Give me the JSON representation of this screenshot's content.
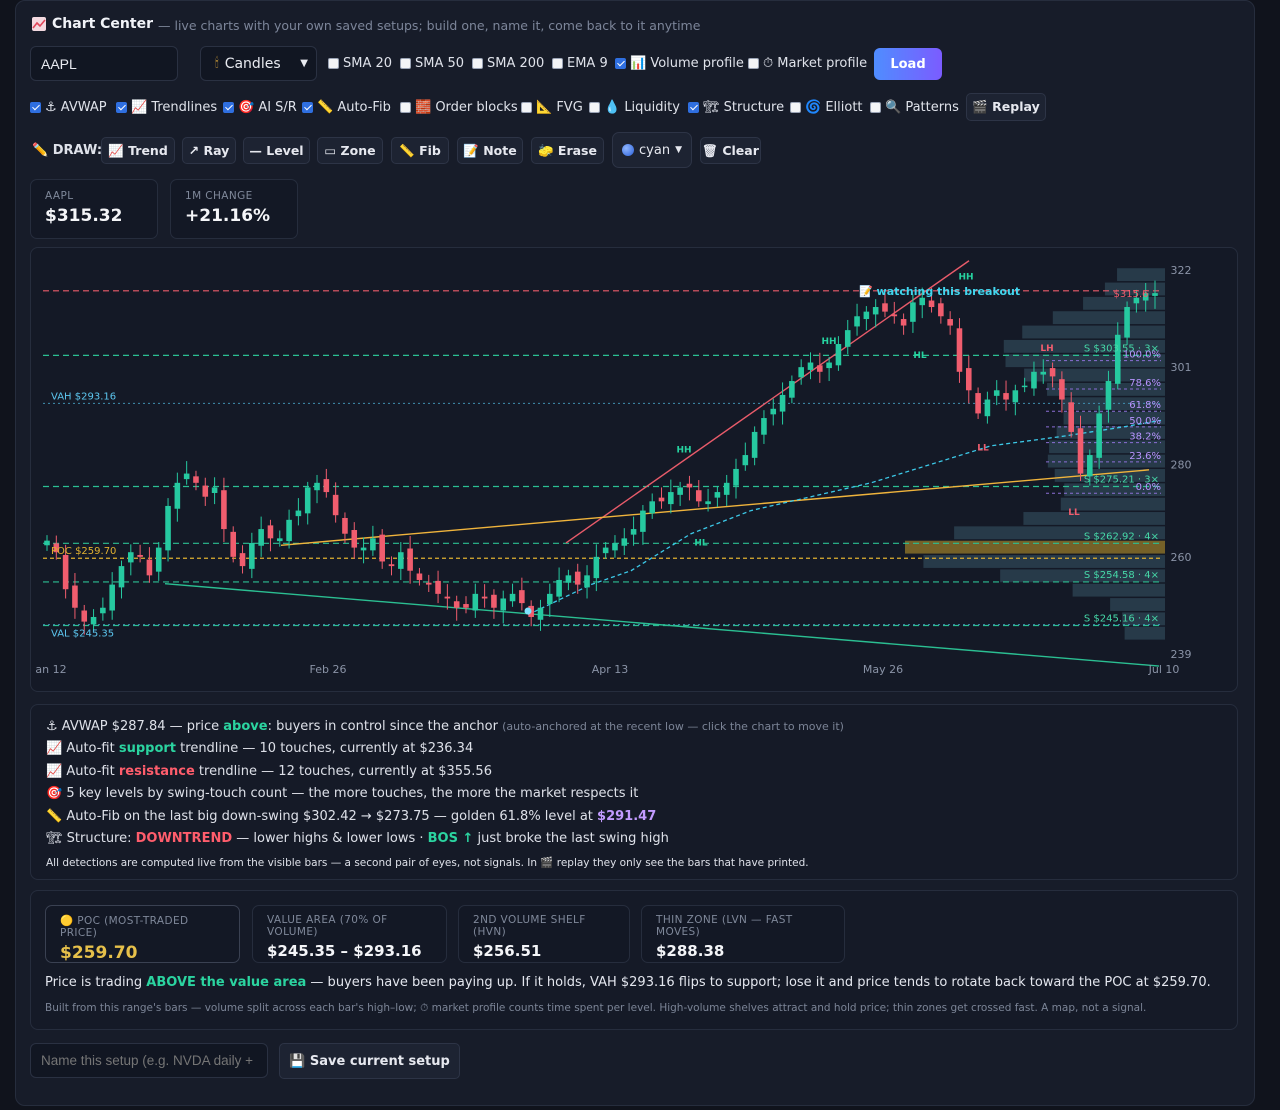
{
  "header": {
    "icon": "chart-icon",
    "title": "Chart Center",
    "subtitle": "— live charts with your own saved setups; build one, name it, come back to it anytime"
  },
  "toolbar": {
    "symbol": "AAPL",
    "chart_type": "Candles",
    "load_label": "Load",
    "overlays": [
      {
        "label": "SMA 20",
        "checked": false
      },
      {
        "label": "SMA 50",
        "checked": false
      },
      {
        "label": "SMA 200",
        "checked": false
      },
      {
        "label": "EMA 9",
        "checked": false
      },
      {
        "label": "📊 Volume profile",
        "checked": true
      },
      {
        "label": "⏱ Market profile",
        "checked": false
      }
    ]
  },
  "detections": {
    "items": [
      {
        "label": "⚓ AVWAP",
        "checked": true
      },
      {
        "label": "📈 Trendlines",
        "checked": true
      },
      {
        "label": "🎯 AI S/R",
        "checked": true
      },
      {
        "label": "📏 Auto-Fib",
        "checked": true
      },
      {
        "label": "🧱 Order blocks",
        "checked": false
      },
      {
        "label": "📐 FVG",
        "checked": false
      },
      {
        "label": "💧 Liquidity",
        "checked": false
      },
      {
        "label": "🏗 Structure",
        "checked": true
      },
      {
        "label": "🌀 Elliott",
        "checked": false
      },
      {
        "label": "🔍 Patterns",
        "checked": false
      }
    ],
    "replay_label": "🎬 Replay"
  },
  "draw": {
    "label": "✏️ DRAW:",
    "tools": [
      "📈 Trend",
      "↗ Ray",
      "— Level",
      "▭ Zone",
      "📏 Fib",
      "📝 Note",
      "🧽 Erase"
    ],
    "color": "cyan",
    "clear_label": "🗑 Clear"
  },
  "stats": {
    "symbol_label": "AAPL",
    "price": "$315.32",
    "change_label": "1M CHANGE",
    "change": "+21.16%"
  },
  "colors": {
    "up": "#26c9a0",
    "down": "#f05d6e",
    "accent": "#5b7cff",
    "poc": "#e0b030",
    "avwap": "#f0b43c",
    "vwap_line": "#3cc9e8",
    "green_text": "#2bd4a0",
    "red_text": "#ff5d6c"
  },
  "chart": {
    "y_ticks": [
      "322",
      "301",
      "280",
      "260",
      "239"
    ],
    "x_ticks": [
      "an 12",
      "Feb 26",
      "Apr 13",
      "May 26",
      "Jul 10"
    ],
    "labels": {
      "vah": "VAH $293.16",
      "poc": "POC $259.70",
      "val": "VAL $245.35",
      "note": "📝 watching this breakout",
      "last_price": "$315.6"
    },
    "sr_labels": [
      "S $303.55 · 3×",
      "S $275.21 · 3×",
      "S $262.92 · 4×",
      "S $254.58 · 4×",
      "S $245.16 · 4×"
    ],
    "fib_labels": [
      "100.0%",
      "78.6%",
      "61.8%",
      "50.0%",
      "38.2%",
      "23.6%",
      "0.0%"
    ],
    "structure_labels": [
      "HH",
      "HH",
      "HL",
      "HH",
      "HL",
      "HH",
      "LH",
      "LL",
      "LL"
    ]
  },
  "chart_data": {
    "type": "candlestick",
    "symbol": "AAPL",
    "x_range": [
      "Jan 12",
      "Jul 10"
    ],
    "ylim": [
      239,
      322
    ],
    "close_series": [
      263.5,
      261,
      253,
      249,
      246,
      247,
      249,
      254,
      258,
      261,
      260,
      256,
      262,
      271,
      276,
      278,
      276,
      273,
      275,
      266,
      260,
      258,
      263,
      266,
      264,
      264,
      268,
      270,
      275,
      276,
      274,
      269,
      265,
      262,
      262,
      264,
      259,
      258,
      261,
      257,
      255,
      254,
      252,
      251,
      249,
      249,
      252,
      251,
      249,
      251,
      252,
      250,
      247,
      249,
      252,
      255,
      256,
      254,
      256,
      260,
      262,
      263,
      264,
      266,
      270,
      272,
      272,
      274,
      275,
      275,
      272,
      272,
      274,
      276,
      279,
      282,
      287,
      290,
      292,
      295,
      298,
      301,
      302,
      300,
      302,
      306,
      309,
      312,
      313,
      314,
      313,
      312,
      310,
      315,
      316,
      314,
      312,
      310,
      300,
      296,
      291,
      294,
      296,
      294,
      296,
      297,
      300,
      300,
      299,
      294,
      287,
      278,
      282,
      291,
      298,
      308,
      314,
      316,
      317,
      317
    ],
    "series": [
      {
        "name": "AVWAP",
        "value": 287.84
      },
      {
        "name": "support trendline",
        "value": 236.34
      },
      {
        "name": "resistance trendline",
        "value": 355.56
      }
    ],
    "support_resistance": [
      303.55,
      275.21,
      262.92,
      254.58,
      245.16
    ],
    "volume_profile": {
      "poc": 259.7,
      "vah": 293.16,
      "val": 245.35,
      "hvn": 256.51,
      "lvn": 288.38
    },
    "fib": {
      "from": 302.42,
      "to": 273.75,
      "golden": 291.47
    }
  },
  "info": {
    "avwap": {
      "a": "⚓ AVWAP $287.84 — price ",
      "b": "above",
      "c": ": buyers in control since the anchor ",
      "d": "(auto-anchored at the recent low — click the chart to move it)"
    },
    "support": {
      "a": "📈 Auto-fit ",
      "b": "support",
      "c": " trendline — 10 touches, currently at $236.34"
    },
    "resistance": {
      "a": "📈 Auto-fit ",
      "b": "resistance",
      "c": " trendline — 12 touches, currently at $355.56"
    },
    "levels": "🎯 5 key levels by swing-touch count — the more touches, the more the market respects it",
    "fib": {
      "a": "📏 Auto-Fib on the last big down-swing $302.42 → $273.75 — golden 61.8% level at ",
      "b": "$291.47"
    },
    "structure": {
      "a": "🏗 Structure: ",
      "b": "DOWNTREND",
      "c": " — lower highs & lower lows · ",
      "d": "BOS ↑",
      "e": " just broke the last swing high"
    },
    "footnote": "All detections are computed live from the visible bars — a second pair of eyes, not signals. In 🎬 replay they only see the bars that have printed."
  },
  "volume_profile": {
    "cards": [
      {
        "label": "🟡 POC (MOST-TRADED PRICE)",
        "value": "$259.70"
      },
      {
        "label": "VALUE AREA (70% OF VOLUME)",
        "value": "$245.35 – $293.16"
      },
      {
        "label": "2ND VOLUME SHELF (HVN)",
        "value": "$256.51"
      },
      {
        "label": "THIN ZONE (LVN — FAST MOVES)",
        "value": "$288.38"
      }
    ],
    "summary": {
      "a": "Price is trading ",
      "b": "ABOVE the value area",
      "c": " — buyers have been paying up. If it holds, VAH $293.16 flips to support; lose it and price tends to rotate back toward the POC at $259.70."
    },
    "footnote": "Built from this range's bars — volume split across each bar's high–low; ⏱ market profile counts time spent per level. High-volume shelves attract and hold price; thin zones get crossed fast. A map, not a signal."
  },
  "save": {
    "placeholder": "Name this setup (e.g. NVDA daily +",
    "button": "💾 Save current setup"
  }
}
